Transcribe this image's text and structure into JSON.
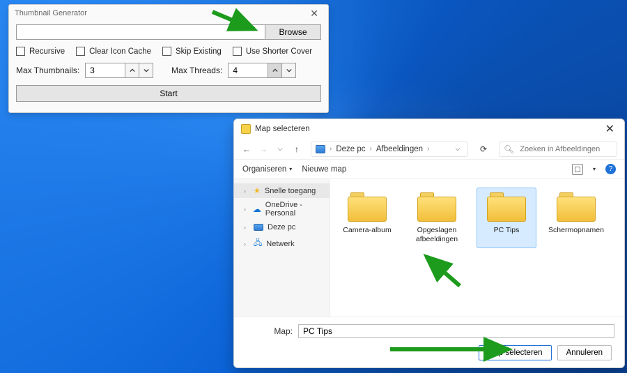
{
  "tg": {
    "title": "Thumbnail Generator",
    "browse": "Browse",
    "checks": {
      "recursive": "Recursive",
      "clear_cache": "Clear Icon Cache",
      "skip_existing": "Skip Existing",
      "use_shorter": "Use Shorter Cover"
    },
    "labels": {
      "max_thumbs": "Max Thumbnails:",
      "max_threads": "Max Threads:"
    },
    "values": {
      "max_thumbs": "3",
      "max_threads": "4"
    },
    "start": "Start"
  },
  "fd": {
    "title": "Map selecteren",
    "crumb": {
      "root": "Deze pc",
      "folder": "Afbeeldingen"
    },
    "search_placeholder": "Zoeken in Afbeeldingen",
    "toolbar": {
      "organize": "Organiseren",
      "new_folder": "Nieuwe map"
    },
    "side": {
      "quick": "Snelle toegang",
      "onedrive": "OneDrive - Personal",
      "thispc": "Deze pc",
      "network": "Netwerk"
    },
    "folders": [
      {
        "name": "Camera-album"
      },
      {
        "name": "Opgeslagen afbeeldingen"
      },
      {
        "name": "PC Tips",
        "selected": true
      },
      {
        "name": "Schermopnamen"
      }
    ],
    "map_label": "Map:",
    "map_value": "PC Tips",
    "buttons": {
      "select": "Map selecteren",
      "cancel": "Annuleren"
    }
  }
}
